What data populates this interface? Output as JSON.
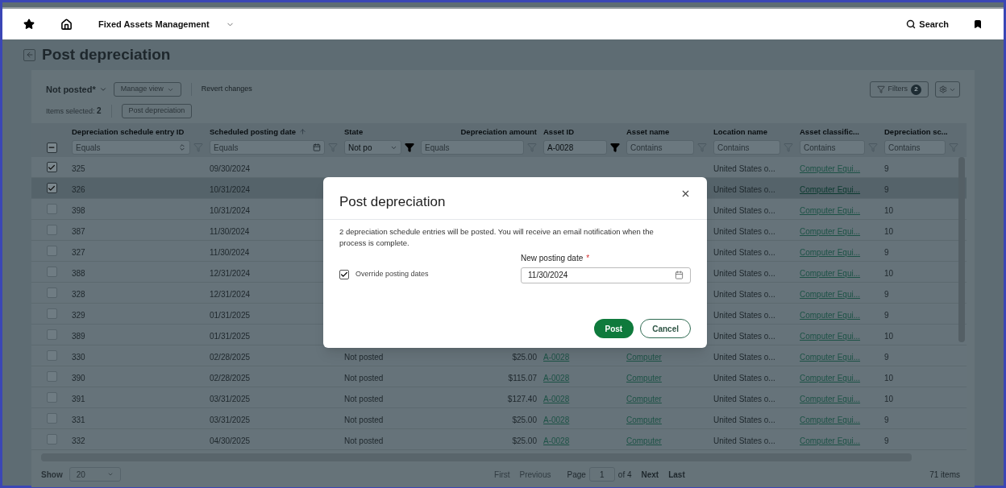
{
  "top_bar": {
    "title": "Fixed Assets Management",
    "search": "Search"
  },
  "page": {
    "title": "Post depreciation"
  },
  "toolbar": {
    "view": "Not posted*",
    "manage_view": "Manage view",
    "revert": "Revert changes",
    "filters": "Filters",
    "filter_count": "2"
  },
  "selection": {
    "label": "Items selected:",
    "count": "2",
    "action": "Post depreciation"
  },
  "table": {
    "header_checkbox": {
      "indeterminate": true
    },
    "columns": [
      {
        "label": "Depreciation schedule entry ID",
        "filter": {
          "kind": "select",
          "placeholder": "Equals",
          "active": false
        }
      },
      {
        "label": "Scheduled posting date",
        "sorted": true,
        "filter": {
          "kind": "date",
          "placeholder": "Equals",
          "active": false
        }
      },
      {
        "label": "State",
        "filter": {
          "kind": "dropdown",
          "value": "Not po",
          "active": true
        }
      },
      {
        "label": "Depreciation amount",
        "filter": {
          "kind": "text",
          "placeholder": "Equals",
          "active": false
        }
      },
      {
        "label": "Asset ID",
        "links": true,
        "filter": {
          "kind": "text",
          "value": "A-0028",
          "active": true
        }
      },
      {
        "label": "Asset name",
        "links": true,
        "filter": {
          "kind": "text",
          "placeholder": "Contains",
          "active": false
        }
      },
      {
        "label": "Location name",
        "filter": {
          "kind": "text",
          "placeholder": "Contains",
          "active": false
        }
      },
      {
        "label": "Asset classific...",
        "links": true,
        "filter": {
          "kind": "text",
          "placeholder": "Contains",
          "active": false
        }
      },
      {
        "label": "Depreciation sc...",
        "filter": {
          "kind": "text",
          "placeholder": "Contains",
          "active": false
        }
      }
    ],
    "rows": [
      {
        "selected": true,
        "hovered": false,
        "cells": [
          "325",
          "09/30/2024",
          null,
          null,
          null,
          null,
          "United States o...",
          "Computer Equi...",
          "9"
        ]
      },
      {
        "selected": true,
        "hovered": true,
        "cells": [
          "326",
          "10/31/2024",
          null,
          null,
          null,
          null,
          "United States o...",
          "Computer Equi...",
          "9"
        ]
      },
      {
        "selected": false,
        "hovered": false,
        "cells": [
          "398",
          "10/31/2024",
          null,
          null,
          null,
          null,
          "United States o...",
          "Computer Equi...",
          "10"
        ]
      },
      {
        "selected": false,
        "hovered": false,
        "cells": [
          "387",
          "11/30/2024",
          null,
          null,
          null,
          null,
          "United States o...",
          "Computer Equi...",
          "10"
        ]
      },
      {
        "selected": false,
        "hovered": false,
        "cells": [
          "327",
          "11/30/2024",
          null,
          null,
          null,
          null,
          "United States o...",
          "Computer Equi...",
          "9"
        ]
      },
      {
        "selected": false,
        "hovered": false,
        "cells": [
          "388",
          "12/31/2024",
          null,
          null,
          null,
          null,
          "United States o...",
          "Computer Equi...",
          "10"
        ]
      },
      {
        "selected": false,
        "hovered": false,
        "cells": [
          "328",
          "12/31/2024",
          null,
          null,
          null,
          null,
          "United States o...",
          "Computer Equi...",
          "9"
        ]
      },
      {
        "selected": false,
        "hovered": false,
        "cells": [
          "329",
          "01/31/2025",
          null,
          null,
          null,
          null,
          "United States o...",
          "Computer Equi...",
          "9"
        ]
      },
      {
        "selected": false,
        "hovered": false,
        "cells": [
          "389",
          "01/31/2025",
          null,
          null,
          null,
          null,
          "United States o...",
          "Computer Equi...",
          "10"
        ]
      },
      {
        "selected": false,
        "hovered": false,
        "cells": [
          "330",
          "02/28/2025",
          "Not posted",
          "$25.00",
          "A-0028",
          "Computer",
          "United States o...",
          "Computer Equi...",
          "9"
        ]
      },
      {
        "selected": false,
        "hovered": false,
        "cells": [
          "390",
          "02/28/2025",
          "Not posted",
          "$115.07",
          "A-0028",
          "Computer",
          "United States o...",
          "Computer Equi...",
          "10"
        ]
      },
      {
        "selected": false,
        "hovered": false,
        "cells": [
          "391",
          "03/31/2025",
          "Not posted",
          "$127.40",
          "A-0028",
          "Computer",
          "United States o...",
          "Computer Equi...",
          "10"
        ]
      },
      {
        "selected": false,
        "hovered": false,
        "cells": [
          "331",
          "03/31/2025",
          "Not posted",
          "$25.00",
          "A-0028",
          "Computer",
          "United States o...",
          "Computer Equi...",
          "9"
        ]
      },
      {
        "selected": false,
        "hovered": false,
        "cells": [
          "332",
          "04/30/2025",
          "Not posted",
          "$25.00",
          "A-0028",
          "Computer",
          "United States o...",
          "Computer Equi...",
          "9"
        ]
      }
    ]
  },
  "footer": {
    "show_label": "Show",
    "page_size": "20",
    "first": {
      "label": "First",
      "disabled": true
    },
    "previous": {
      "label": "Previous",
      "disabled": true
    },
    "page_label": "Page",
    "page": "1",
    "of": "of 4",
    "next": {
      "label": "Next",
      "disabled": false
    },
    "last": {
      "label": "Last",
      "disabled": false
    },
    "total": "71 items"
  },
  "dialog": {
    "title": "Post depreciation",
    "message": "2 depreciation schedule entries will be posted. You will receive an email notification when the process is complete.",
    "override": {
      "label": "Override posting dates",
      "checked": true
    },
    "date_field": {
      "label": "New posting date",
      "required_mark": "*",
      "value": "11/30/2024"
    },
    "primary": "Post",
    "secondary": "Cancel"
  }
}
